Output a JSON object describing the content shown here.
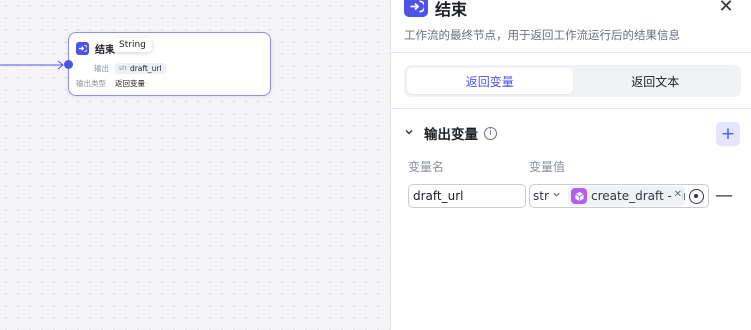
{
  "canvas": {
    "node": {
      "title": "结束",
      "tooltip": "String",
      "output_label": "输出",
      "output_type": "str",
      "output_value": "draft_url",
      "output_mode_label": "输出类型",
      "output_mode_value": "返回变量"
    }
  },
  "panel": {
    "title": "结束",
    "close_symbol": "✕",
    "description": "工作流的最终节点，用于返回工作流运行后的结果信息",
    "tabs": [
      {
        "label": "返回变量",
        "active": true
      },
      {
        "label": "返回文本",
        "active": false
      }
    ],
    "output_section": {
      "title": "输出变量",
      "info_symbol": "i",
      "add_symbol": "+",
      "col_name": "变量名",
      "col_value": "变量值",
      "rows": [
        {
          "name": "draft_url",
          "type": "str",
          "ref_text": "create_draft - draft_url",
          "remove_symbol": "—"
        }
      ]
    }
  },
  "icons": {
    "node_icon": "end-node-icon",
    "panel_icon": "end-node-icon",
    "ref_icon": "plugin-cube-icon",
    "target": "target-icon"
  },
  "colors": {
    "accent": "#4d53e8",
    "node_border": "#8c8df7",
    "plugin": "#b25eee"
  }
}
